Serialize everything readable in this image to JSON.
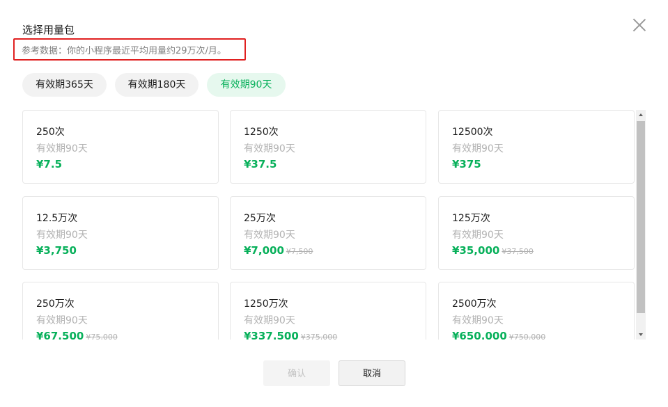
{
  "dialog": {
    "title": "选择用量包",
    "hint": "参考数据：你的小程序最近平均用量约29万次/月。"
  },
  "tabs": [
    {
      "label": "有效期365天",
      "active": false
    },
    {
      "label": "有效期180天",
      "active": false
    },
    {
      "label": "有效期90天",
      "active": true
    }
  ],
  "packages": [
    {
      "count": "250次",
      "period": "有效期90天",
      "price": "¥7.5",
      "original": ""
    },
    {
      "count": "1250次",
      "period": "有效期90天",
      "price": "¥37.5",
      "original": ""
    },
    {
      "count": "12500次",
      "period": "有效期90天",
      "price": "¥375",
      "original": ""
    },
    {
      "count": "12.5万次",
      "period": "有效期90天",
      "price": "¥3,750",
      "original": ""
    },
    {
      "count": "25万次",
      "period": "有效期90天",
      "price": "¥7,000",
      "original": "¥7,500"
    },
    {
      "count": "125万次",
      "period": "有效期90天",
      "price": "¥35,000",
      "original": "¥37,500"
    },
    {
      "count": "250万次",
      "period": "有效期90天",
      "price": "¥67.500",
      "original": "¥75,000"
    },
    {
      "count": "1250万次",
      "period": "有效期90天",
      "price": "¥337.500",
      "original": "¥375,000"
    },
    {
      "count": "2500万次",
      "period": "有效期90天",
      "price": "¥650.000",
      "original": "¥750,000"
    }
  ],
  "buttons": {
    "confirm": "确认",
    "cancel": "取消"
  },
  "colors": {
    "accent": "#07b05a",
    "active_tab_bg": "#e6f8ee",
    "highlight_border": "#e02020"
  },
  "icons": {
    "close": "close-icon",
    "scroll_up": "arrow-up-icon",
    "scroll_down": "arrow-down-icon"
  }
}
